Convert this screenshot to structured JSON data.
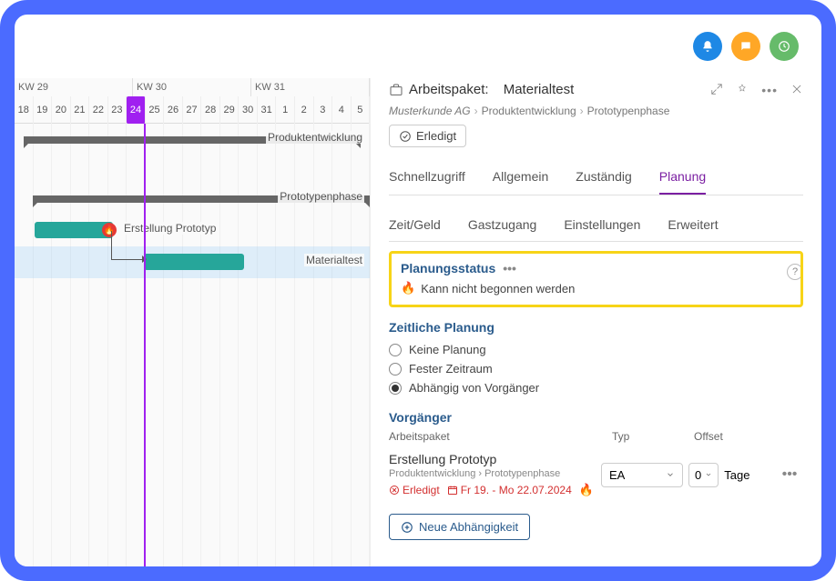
{
  "top_icons": {
    "bell": "bell-icon",
    "chat": "chat-icon",
    "clock": "clock-icon"
  },
  "gantt": {
    "weeks": [
      "KW 29",
      "KW 30",
      "KW 31"
    ],
    "days": [
      "18",
      "19",
      "20",
      "21",
      "22",
      "23",
      "24",
      "25",
      "26",
      "27",
      "28",
      "29",
      "30",
      "31",
      "1",
      "2",
      "3",
      "4",
      "5"
    ],
    "today_index": 6,
    "rows": [
      {
        "label": "Produktentwicklung"
      },
      {
        "label": "Prototypenphase"
      },
      {
        "label": "Erstellung Prototyp"
      },
      {
        "label": "Materialtest"
      }
    ]
  },
  "panel": {
    "type_label": "Arbeitspaket:",
    "title": "Materialtest",
    "breadcrumb": [
      "Musterkunde AG",
      "Produktentwicklung",
      "Prototypenphase"
    ],
    "done_label": "Erledigt",
    "tabs_row1": [
      "Schnellzugriff",
      "Allgemein",
      "Zuständig",
      "Planung"
    ],
    "tabs_row2": [
      "Zeit/Geld",
      "Gastzugang",
      "Einstellungen",
      "Erweitert"
    ],
    "active_tab": "Planung",
    "status_section": {
      "title": "Planungsstatus",
      "text": "Kann nicht begonnen werden"
    },
    "time_section": {
      "title": "Zeitliche Planung",
      "options": [
        "Keine Planung",
        "Fester Zeitraum",
        "Abhängig von Vorgänger"
      ],
      "selected_index": 2
    },
    "pred_section": {
      "title": "Vorgänger",
      "columns": {
        "wp": "Arbeitspaket",
        "typ": "Typ",
        "offset": "Offset"
      },
      "row": {
        "name": "Erstellung Prototyp",
        "path": [
          "Produktentwicklung",
          "Prototypenphase"
        ],
        "status": "Erledigt",
        "date": "Fr 19. - Mo 22.07.2024",
        "typ": "EA",
        "offset_value": "0",
        "offset_unit": "Tage"
      },
      "add_label": "Neue Abhängigkeit"
    }
  }
}
